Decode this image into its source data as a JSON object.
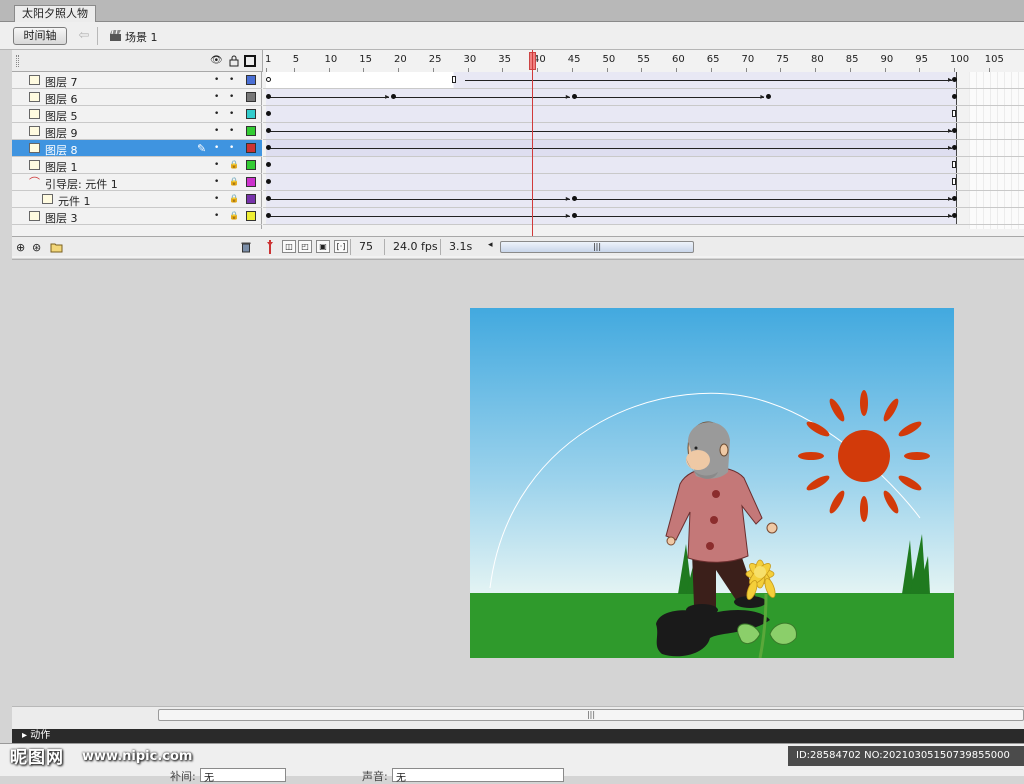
{
  "document": {
    "tab_title": "太阳夕照人物"
  },
  "toolbar": {
    "timeline_button": "时间轴",
    "scene_label": "场景 1"
  },
  "ruler": {
    "numbers": [
      "1",
      "5",
      "10",
      "15",
      "20",
      "25",
      "30",
      "35",
      "40",
      "45",
      "50",
      "55",
      "60",
      "65",
      "70",
      "75",
      "80",
      "85",
      "90",
      "95",
      "100",
      "105"
    ]
  },
  "layers": [
    {
      "name": "图层 7",
      "color": "#4a6fd4",
      "locked": false,
      "type": "normal"
    },
    {
      "name": "图层 6",
      "color": "#777777",
      "locked": false,
      "type": "normal"
    },
    {
      "name": "图层 5",
      "color": "#33cccc",
      "locked": false,
      "type": "normal"
    },
    {
      "name": "图层 9",
      "color": "#33cc33",
      "locked": false,
      "type": "normal"
    },
    {
      "name": "图层 8",
      "color": "#cc3333",
      "locked": false,
      "type": "normal",
      "selected": true
    },
    {
      "name": "图层 1",
      "color": "#33cc33",
      "locked": true,
      "type": "normal"
    },
    {
      "name": "引导层: 元件 1",
      "color": "#cc33cc",
      "locked": true,
      "type": "guide"
    },
    {
      "name": "元件 1",
      "color": "#7733aa",
      "locked": true,
      "type": "guided"
    },
    {
      "name": "图层 3",
      "color": "#eeee33",
      "locked": true,
      "type": "normal"
    }
  ],
  "footer": {
    "current_frame": "75",
    "fps": "24.0 fps",
    "time": "3.1s"
  },
  "panels": {
    "actions_title": "动作",
    "tween_label": "补间:",
    "tween_value": "无",
    "sound_label": "声音:",
    "sound_value": "无"
  },
  "watermark": {
    "brand": "昵图网",
    "url": "www.nipic.com",
    "id_text": "ID:28584702 NO:20210305150739855000"
  },
  "colors": {
    "sky_top": "#42a9df",
    "sky_bottom": "#d9f0f5",
    "grass": "#2f9a2c",
    "sun": "#d23a0a",
    "selected_row": "#3f94e0"
  }
}
